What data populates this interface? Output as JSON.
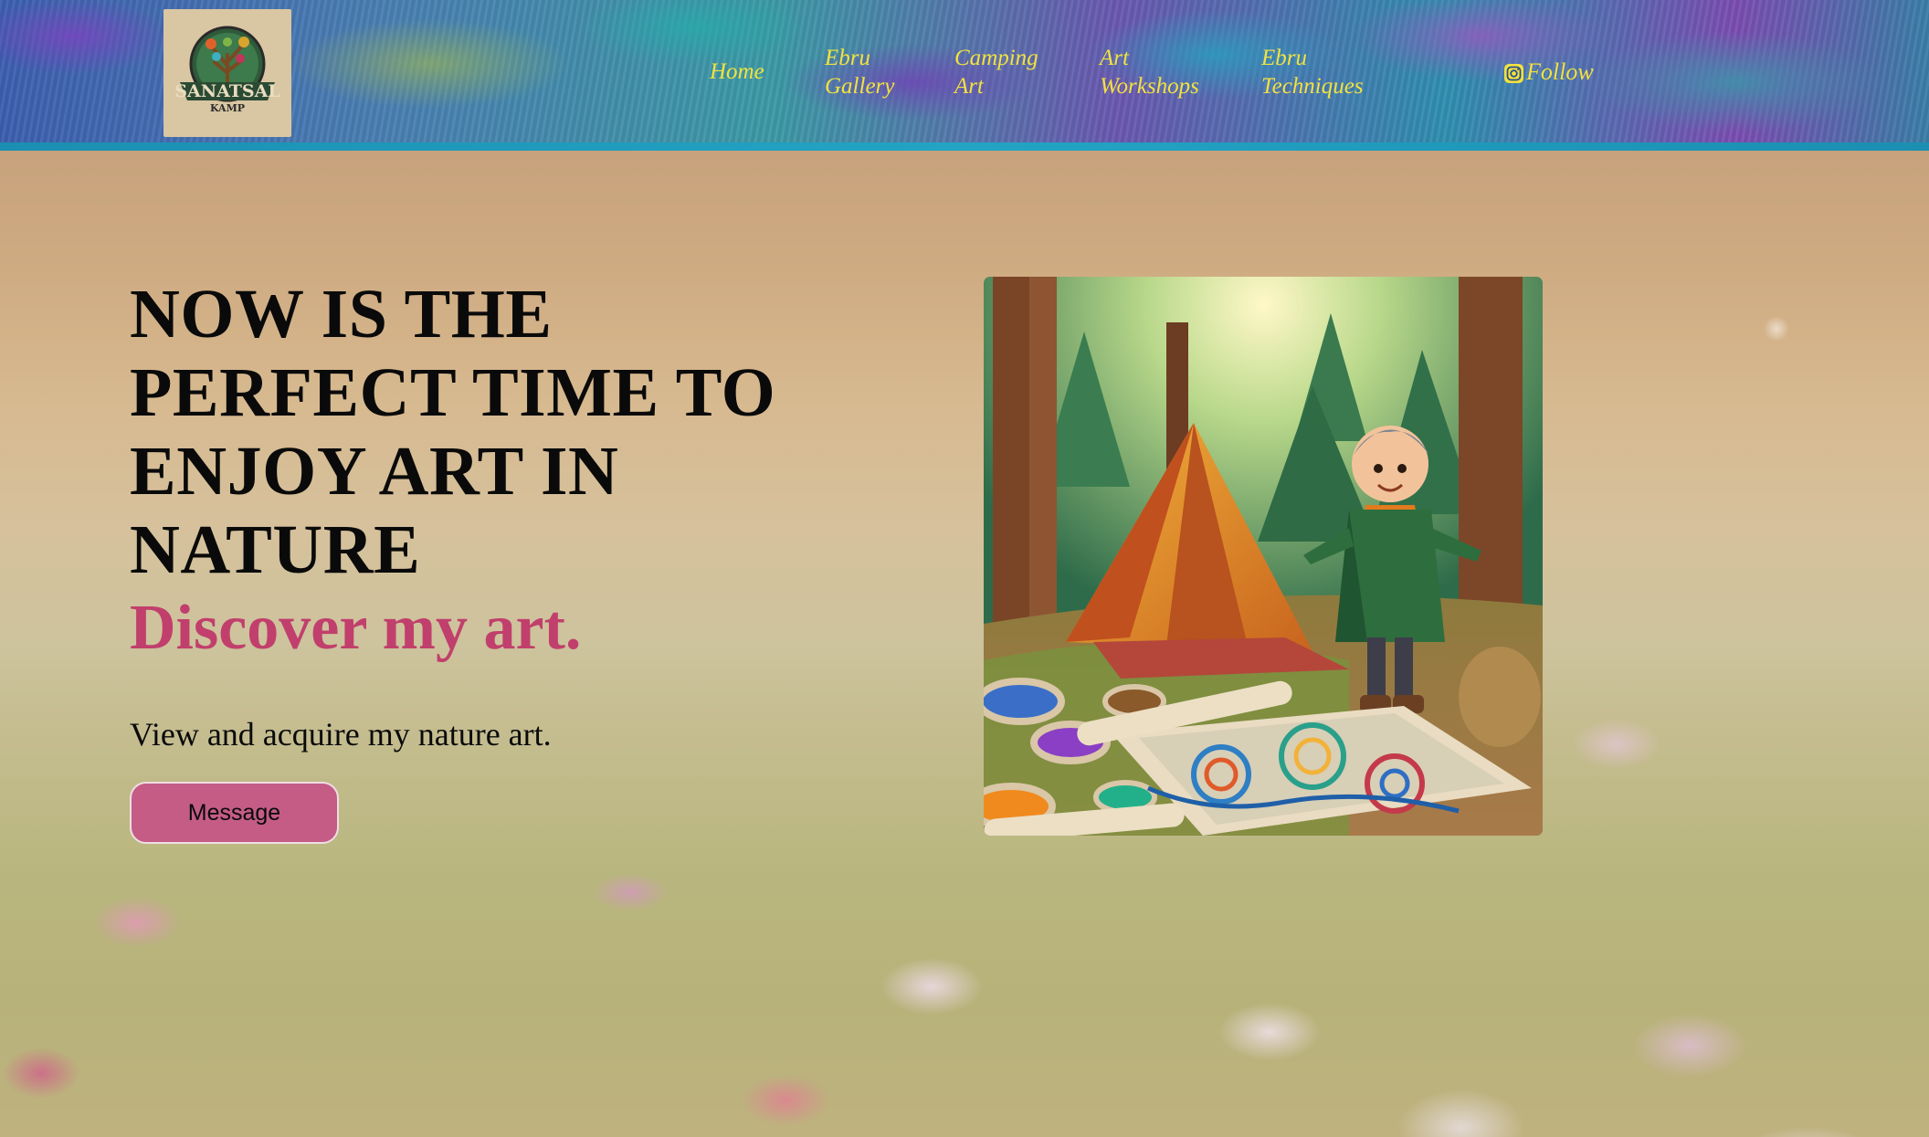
{
  "header": {
    "logo": {
      "label_top": "SANATSAL",
      "label_bottom": "KAMP",
      "icon": "tree-palette-emblem-icon"
    },
    "nav": [
      {
        "lines": [
          "Home"
        ]
      },
      {
        "lines": [
          "Ebru",
          "Gallery"
        ]
      },
      {
        "lines": [
          "Camping",
          "Art"
        ]
      },
      {
        "lines": [
          "Art",
          "Workshops"
        ]
      },
      {
        "lines": [
          "Ebru",
          "Techniques"
        ]
      }
    ],
    "follow": {
      "label": "Follow",
      "icon": "instagram-icon"
    },
    "nav_color": "#f2e23e",
    "border_color": "#1b8fb1"
  },
  "hero": {
    "headline_lines": [
      "NOW IS THE",
      "PERFECT TIME TO",
      "ENJOY ART IN",
      "NATURE"
    ],
    "subheadline": "Discover my art.",
    "tagline": "View and acquire my nature art.",
    "button_label": "Message",
    "accent_color": "#c13f6c",
    "button_color": "#c45c86",
    "illustration": {
      "icon": "camping-artist-illustration"
    }
  }
}
